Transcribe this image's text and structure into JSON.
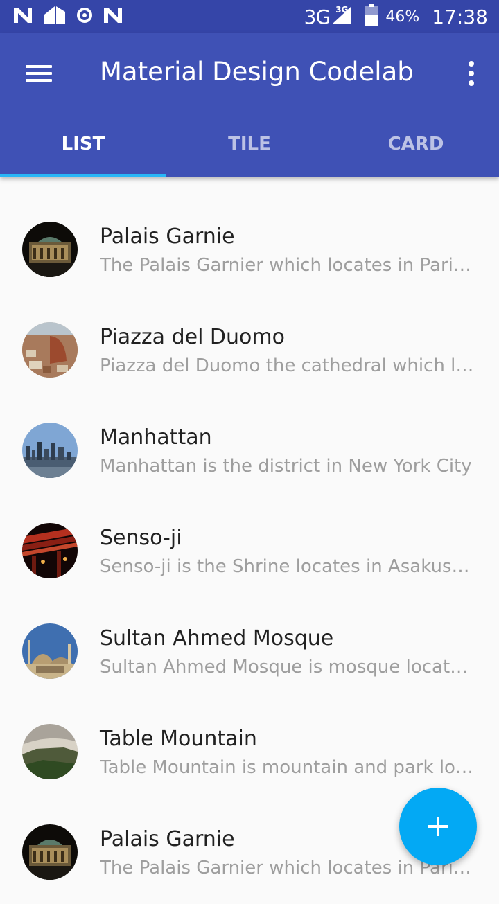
{
  "status_bar": {
    "icons_left": [
      "notification-n-icon",
      "home-notification-icon",
      "record-icon",
      "notification-n-icon"
    ],
    "network": "3G",
    "network_superscript": "3G",
    "battery_percent": "46%",
    "time": "17:38"
  },
  "app_bar": {
    "title": "Material Design Codelab",
    "menu_icon": "hamburger-menu-icon",
    "overflow_icon": "more-vert-icon",
    "color": "#3f51b5"
  },
  "tabs": [
    {
      "label": "LIST",
      "active": true
    },
    {
      "label": "TILE",
      "active": false
    },
    {
      "label": "CARD",
      "active": false
    }
  ],
  "accent_color": "#29b6f6",
  "list": [
    {
      "title": "Palais Garnie",
      "description": "The Palais Garnier which locates in Paris…",
      "image": "palais-garnier-image"
    },
    {
      "title": "Piazza del Duomo",
      "description": "Piazza del Duomo the cathedral which loc…",
      "image": "piazza-del-duomo-image"
    },
    {
      "title": "Manhattan",
      "description": "Manhattan is the district in New York City",
      "image": "manhattan-image"
    },
    {
      "title": "Senso-ji",
      "description": "Senso-ji is the Shrine locates in Asakusa T…",
      "image": "senso-ji-image"
    },
    {
      "title": "Sultan Ahmed Mosque",
      "description": "Sultan Ahmed Mosque is mosque locates…",
      "image": "sultan-ahmed-mosque-image"
    },
    {
      "title": "Table Mountain",
      "description": "Table Mountain is mountain and park loca…",
      "image": "table-mountain-image"
    },
    {
      "title": "Palais Garnie",
      "description": "The Palais Garnier which locates in Paris…",
      "image": "palais-garnier-image"
    }
  ],
  "fab": {
    "icon": "add-icon",
    "color": "#03a9f4"
  }
}
